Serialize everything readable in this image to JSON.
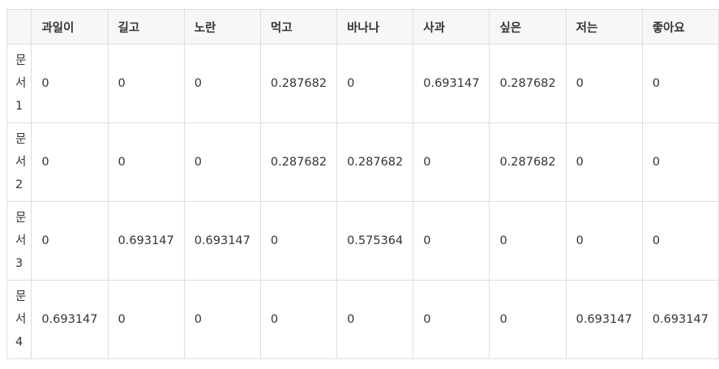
{
  "table": {
    "corner": "",
    "columns": [
      "과일이",
      "길고",
      "노란",
      "먹고",
      "바나나",
      "사과",
      "싶은",
      "저는",
      "좋아요"
    ],
    "rows": [
      {
        "label": "문서1",
        "cells": [
          "0",
          "0",
          "0",
          "0.287682",
          "0",
          "0.693147",
          "0.287682",
          "0",
          "0"
        ]
      },
      {
        "label": "문서2",
        "cells": [
          "0",
          "0",
          "0",
          "0.287682",
          "0.287682",
          "0",
          "0.287682",
          "0",
          "0"
        ]
      },
      {
        "label": "문서3",
        "cells": [
          "0",
          "0.693147",
          "0.693147",
          "0",
          "0.575364",
          "0",
          "0",
          "0",
          "0"
        ]
      },
      {
        "label": "문서4",
        "cells": [
          "0.693147",
          "0",
          "0",
          "0",
          "0",
          "0",
          "0",
          "0.693147",
          "0.693147"
        ]
      }
    ]
  }
}
